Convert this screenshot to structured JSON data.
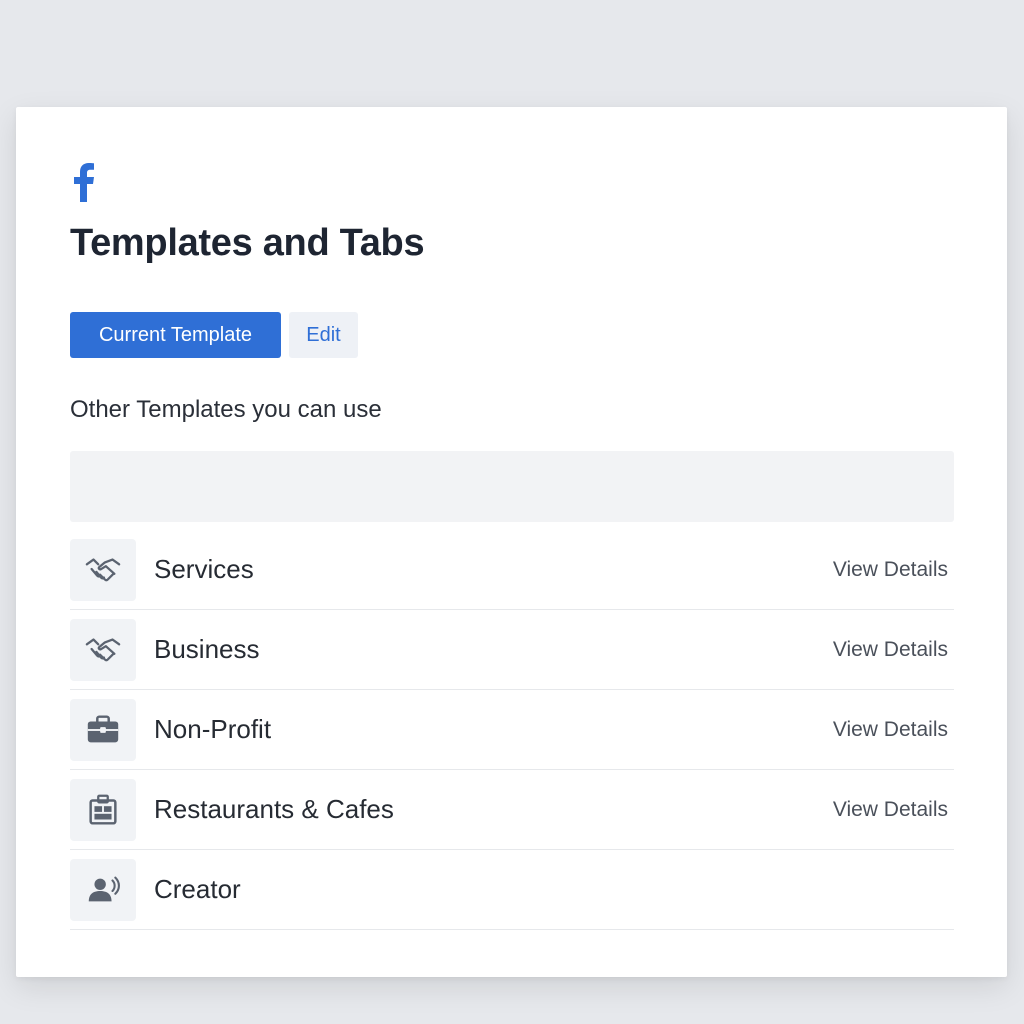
{
  "header": {
    "logo_icon": "facebook-icon",
    "title": "Templates and Tabs"
  },
  "buttons": {
    "current_template": "Current Template",
    "edit": "Edit"
  },
  "section": {
    "title": "Other Templates you can use"
  },
  "search": {
    "placeholder": ""
  },
  "templates": [
    {
      "label": "Services",
      "icon": "handshake-icon",
      "action": "View Details"
    },
    {
      "label": "Business",
      "icon": "handshake-icon",
      "action": "View Details"
    },
    {
      "label": "Non-Profit",
      "icon": "briefcase-icon",
      "action": "View Details"
    },
    {
      "label": "Restaurants & Cafes",
      "icon": "restaurant-icon",
      "action": "View Details"
    },
    {
      "label": "Creator",
      "icon": "creator-icon",
      "action": ""
    }
  ],
  "colors": {
    "accent": "#2f6fd6",
    "icon": "#5b6370",
    "background": "#e6e8ec"
  }
}
